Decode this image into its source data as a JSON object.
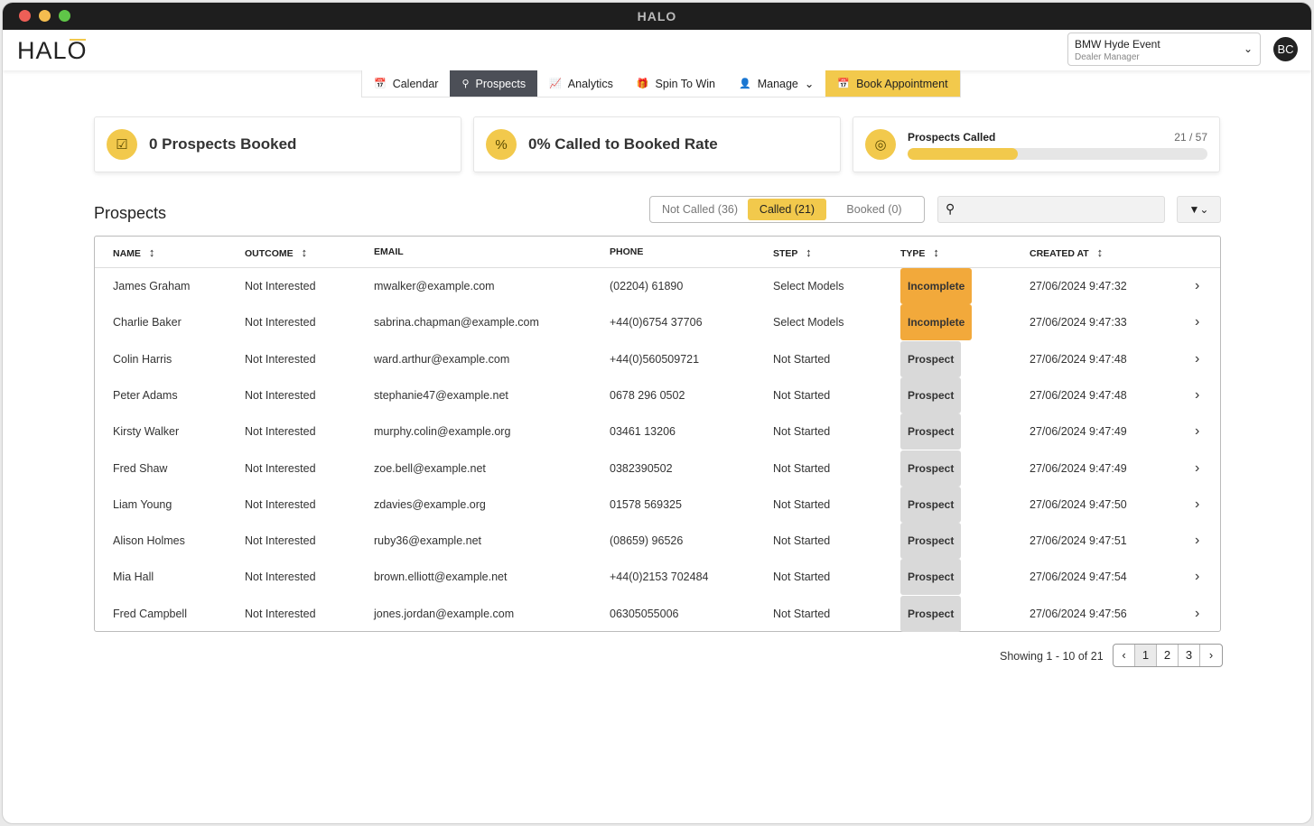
{
  "window": {
    "title": "HALO"
  },
  "header": {
    "logo": "HALO",
    "event": {
      "name": "BMW Hyde Event",
      "role": "Dealer Manager"
    },
    "avatar": "BC"
  },
  "nav": [
    {
      "label": "Calendar",
      "icon": "calendar-icon"
    },
    {
      "label": "Prospects",
      "icon": "search-icon",
      "active": true
    },
    {
      "label": "Analytics",
      "icon": "chart-icon"
    },
    {
      "label": "Spin To Win",
      "icon": "gift-icon"
    },
    {
      "label": "Manage",
      "icon": "user-icon"
    },
    {
      "label": "Book Appointment",
      "icon": "calendar-plus-icon"
    }
  ],
  "stats": {
    "booked": "0 Prospects Booked",
    "rate": "0% Called to Booked Rate",
    "called_label": "Prospects Called",
    "called_value": "21 / 57",
    "called_fraction": 0.368
  },
  "prospects": {
    "title": "Prospects",
    "tabs": [
      "Not Called (36)",
      "Called (21)",
      "Booked (0)"
    ],
    "active_tab": 1,
    "search_value": ""
  },
  "table": {
    "columns": [
      "NAME",
      "OUTCOME",
      "EMAIL",
      "PHONE",
      "STEP",
      "TYPE",
      "CREATED AT"
    ],
    "rows": [
      [
        "James Graham",
        "Not Interested",
        "mwalker@example.com",
        "(02204) 61890",
        "Select Models",
        "Incomplete",
        "27/06/2024 9:47:32"
      ],
      [
        "Charlie Baker",
        "Not Interested",
        "sabrina.chapman@example.com",
        "+44(0)6754 37706",
        "Select Models",
        "Incomplete",
        "27/06/2024 9:47:33"
      ],
      [
        "Colin Harris",
        "Not Interested",
        "ward.arthur@example.com",
        "+44(0)560509721",
        "Not Started",
        "Prospect",
        "27/06/2024 9:47:48"
      ],
      [
        "Peter Adams",
        "Not Interested",
        "stephanie47@example.net",
        "0678 296 0502",
        "Not Started",
        "Prospect",
        "27/06/2024 9:47:48"
      ],
      [
        "Kirsty Walker",
        "Not Interested",
        "murphy.colin@example.org",
        "03461 13206",
        "Not Started",
        "Prospect",
        "27/06/2024 9:47:49"
      ],
      [
        "Fred Shaw",
        "Not Interested",
        "zoe.bell@example.net",
        "0382390502",
        "Not Started",
        "Prospect",
        "27/06/2024 9:47:49"
      ],
      [
        "Liam Young",
        "Not Interested",
        "zdavies@example.org",
        "01578 569325",
        "Not Started",
        "Prospect",
        "27/06/2024 9:47:50"
      ],
      [
        "Alison Holmes",
        "Not Interested",
        "ruby36@example.net",
        "(08659) 96526",
        "Not Started",
        "Prospect",
        "27/06/2024 9:47:51"
      ],
      [
        "Mia Hall",
        "Not Interested",
        "brown.elliott@example.net",
        "+44(0)2153 702484",
        "Not Started",
        "Prospect",
        "27/06/2024 9:47:54"
      ],
      [
        "Fred Campbell",
        "Not Interested",
        "jones.jordan@example.com",
        "06305055006",
        "Not Started",
        "Prospect",
        "27/06/2024 9:47:56"
      ]
    ]
  },
  "pagination": {
    "showing": "Showing 1 - 10 of 21",
    "pages": [
      "1",
      "2",
      "3"
    ],
    "current": "1"
  },
  "colors": {
    "accent": "#f2c94c",
    "incomplete": "#f2a93b",
    "prospect": "#d9d9d9",
    "nav_active": "#4c4f57"
  }
}
